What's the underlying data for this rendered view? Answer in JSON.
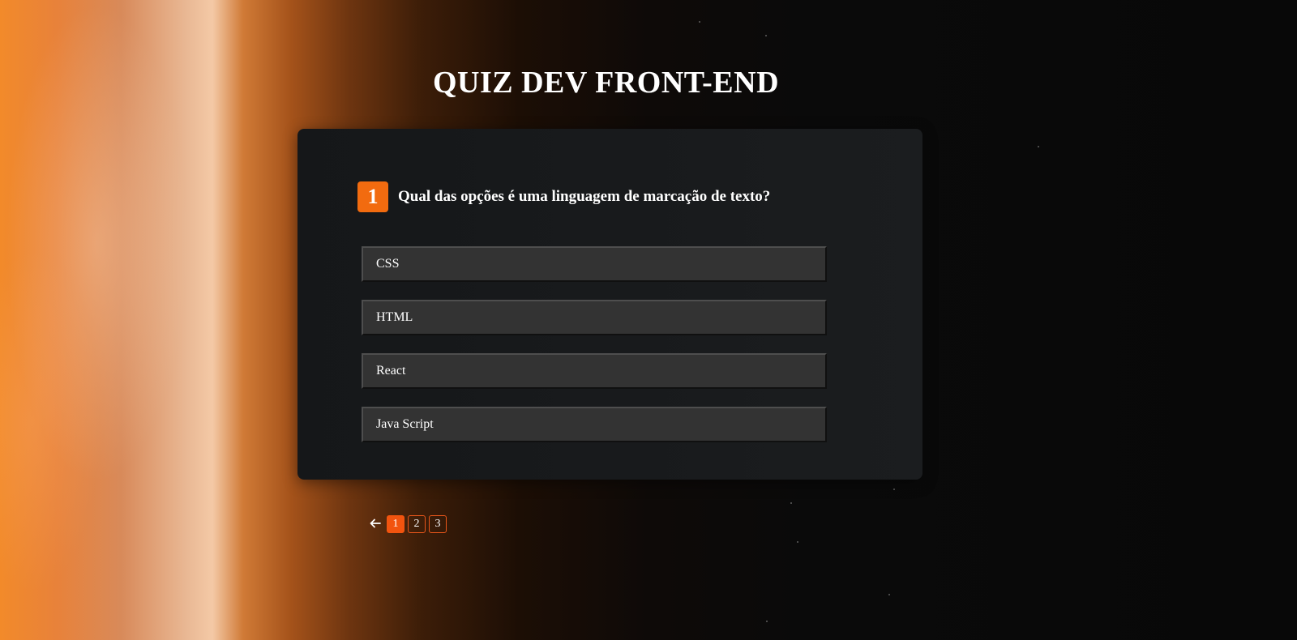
{
  "header": {
    "title": "QUIZ DEV FRONT-END"
  },
  "question": {
    "number": "1",
    "text": "Qual das opções é uma linguagem de marcação de texto?",
    "options": [
      "CSS",
      "HTML",
      "React",
      "Java Script"
    ]
  },
  "pagination": {
    "prev_icon": "arrow-left-icon",
    "pages": [
      "1",
      "2",
      "3"
    ],
    "current": "1"
  },
  "colors": {
    "accent": "#f26b0f",
    "card_bg": "#1b1d1f",
    "option_bg": "#333333",
    "page_border": "#e8561a"
  }
}
